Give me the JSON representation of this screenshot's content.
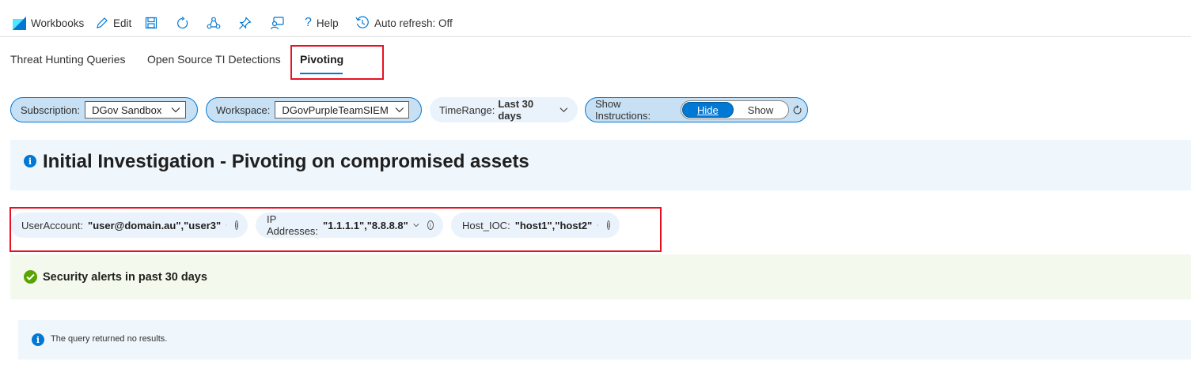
{
  "toolbar": {
    "workbooks_label": "Workbooks",
    "edit_label": "Edit",
    "help_label": "Help",
    "autorefresh_label": "Auto refresh: Off"
  },
  "tabs": [
    {
      "label": "Threat Hunting Queries"
    },
    {
      "label": "Open Source TI Detections"
    },
    {
      "label": "Pivoting"
    }
  ],
  "params": {
    "subscription": {
      "label": "Subscription:",
      "value": "DGov Sandbox"
    },
    "workspace": {
      "label": "Workspace:",
      "value": "DGovPurpleTeamSIEM"
    },
    "timerange": {
      "label": "TimeRange:",
      "value": "Last 30 days"
    },
    "instructions": {
      "label": "Show Instructions:",
      "options": [
        "Hide",
        "Show"
      ],
      "selected": "Hide"
    }
  },
  "banner": {
    "title": "Initial Investigation - Pivoting on compromised assets"
  },
  "pivot_params": {
    "user": {
      "label": "UserAccount:",
      "value": "\"user@domain.au\",\"user3\""
    },
    "ip": {
      "label": "IP Addresses:",
      "value": "\"1.1.1.1\",\"8.8.8.8\""
    },
    "host": {
      "label": "Host_IOC:",
      "value": "\"host1\",\"host2\""
    }
  },
  "alerts": {
    "title": "Security alerts in past 30 days"
  },
  "query": {
    "message": "The query returned no results."
  },
  "colors": {
    "accent": "#0078d4",
    "highlight": "#e81123",
    "success": "#57a300"
  }
}
